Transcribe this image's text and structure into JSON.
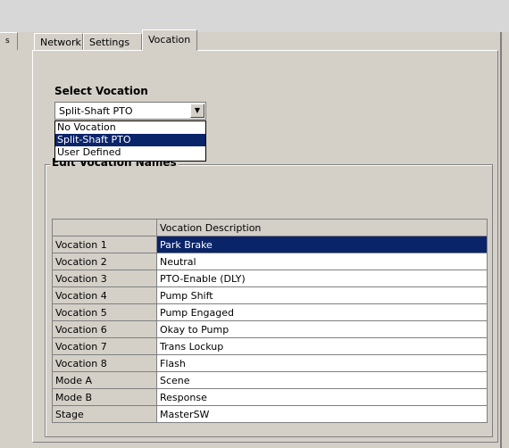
{
  "left_tab_stub": {
    "label": "s"
  },
  "tabs": [
    {
      "label": "Network",
      "active": false
    },
    {
      "label": "Settings",
      "active": false
    },
    {
      "label": "Vocation",
      "active": true
    }
  ],
  "vocation": {
    "select_label": "Select Vocation",
    "selected": "Split-Shaft PTO",
    "options": [
      "No Vocation",
      "Split-Shaft PTO",
      "User Defined"
    ],
    "group_title": "Edit Vocation Names"
  },
  "grid": {
    "header": "Vocation Description",
    "rows": [
      {
        "name": "Vocation 1",
        "description": "Park Brake",
        "selected": true
      },
      {
        "name": "Vocation 2",
        "description": "Neutral"
      },
      {
        "name": "Vocation 3",
        "description": "PTO-Enable (DLY)"
      },
      {
        "name": "Vocation 4",
        "description": "Pump Shift"
      },
      {
        "name": "Vocation 5",
        "description": "Pump Engaged"
      },
      {
        "name": "Vocation 6",
        "description": "Okay to Pump"
      },
      {
        "name": "Vocation 7",
        "description": "Trans Lockup"
      },
      {
        "name": "Vocation 8",
        "description": "Flash"
      },
      {
        "name": "Mode A",
        "description": "Scene"
      },
      {
        "name": "Mode B",
        "description": "Response"
      },
      {
        "name": "Stage",
        "description": "MasterSW"
      }
    ]
  },
  "colors": {
    "selection": "#0a246a",
    "dialog_face": "#d4d0c8"
  }
}
